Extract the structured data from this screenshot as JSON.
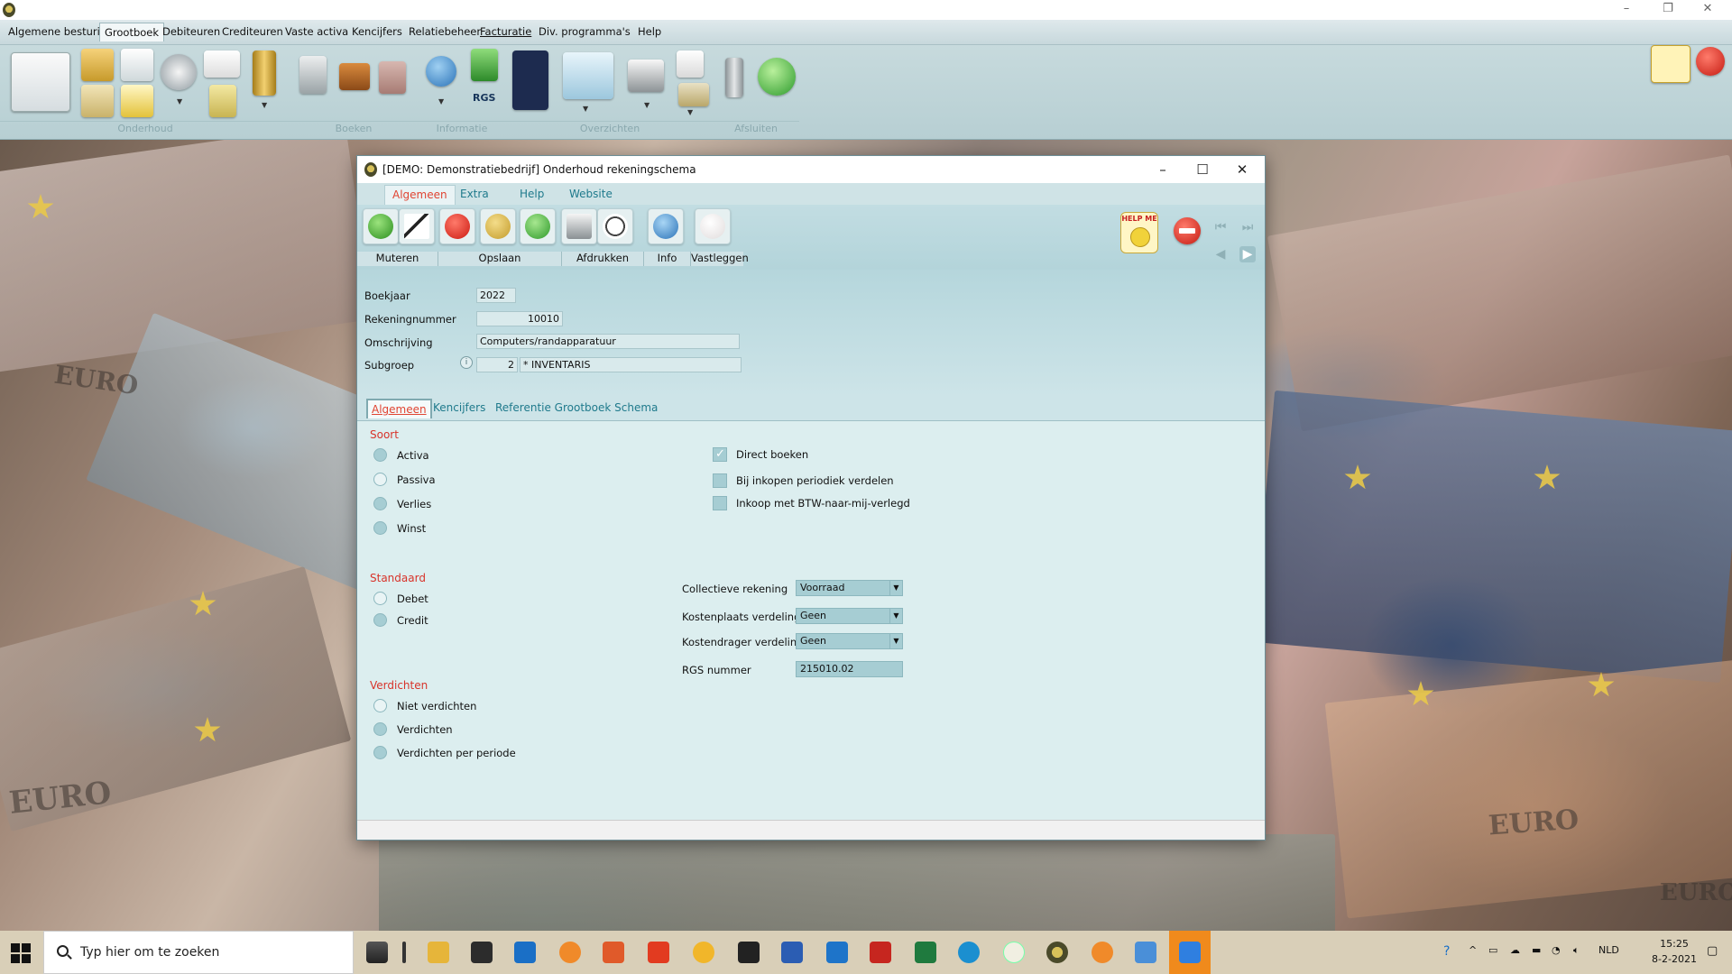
{
  "menubar": {
    "items": [
      "Algemene besturing",
      "Grootboek",
      "Debiteuren",
      "Crediteuren",
      "Vaste activa",
      "Kencijfers",
      "Relatiebeheer",
      "Facturatie",
      "Div. programma's",
      "Help"
    ]
  },
  "ribbon": {
    "groups": [
      "Onderhoud",
      "Boeken",
      "Informatie",
      "Overzichten",
      "Afsluiten"
    ],
    "rgs_label": "RGS"
  },
  "dialog": {
    "title": "[DEMO: Demonstratiebedrijf]  Onderhoud rekeningschema",
    "menu": [
      "Algemeen",
      "Extra",
      "Help",
      "Website"
    ],
    "toolbar_groups": [
      "Muteren",
      "Opslaan",
      "Afdrukken",
      "Info",
      "Vastleggen"
    ],
    "helpme_text": "HELP ME",
    "form": {
      "boekjaar_label": "Boekjaar",
      "boekjaar": "2022",
      "rekeningnummer_label": "Rekeningnummer",
      "rekeningnummer": "10010",
      "omschrijving_label": "Omschrijving",
      "omschrijving": "Computers/randapparatuur",
      "subgroep_label": "Subgroep",
      "subgroep_nr": "2",
      "subgroep_naam": "* INVENTARIS"
    },
    "tabs": [
      "Algemeen",
      "Kencijfers",
      "Referentie Grootboek Schema"
    ],
    "soort": {
      "title": "Soort",
      "options": [
        "Activa",
        "Passiva",
        "Verlies",
        "Winst"
      ]
    },
    "standaard": {
      "title": "Standaard",
      "options": [
        "Debet",
        "Credit"
      ]
    },
    "verdichten": {
      "title": "Verdichten",
      "options": [
        "Niet verdichten",
        "Verdichten",
        "Verdichten per periode"
      ]
    },
    "checkboxes": {
      "direct_boeken": "Direct boeken",
      "inkopen_periodiek": "Bij inkopen periodiek verdelen",
      "inkoop_btw": "Inkoop met BTW-naar-mij-verlegd"
    },
    "selects": {
      "collectieve_label": "Collectieve rekening",
      "collectieve_value": "Voorraad",
      "kostenplaats_label": "Kostenplaats verdeling",
      "kostenplaats_value": "Geen",
      "kostendrager_label": "Kostendrager verdeling",
      "kostendrager_value": "Geen",
      "rgs_label": "RGS nummer",
      "rgs_value": "215010.02"
    }
  },
  "desktop_text": {
    "euro1": "EURO",
    "euro2": "EURO",
    "euro3": "EURO",
    "euro4": "EURO"
  },
  "taskbar": {
    "search_placeholder": "Typ hier om te zoeken",
    "language": "NLD",
    "time": "15:25",
    "date": "8-2-2021"
  },
  "colors": {
    "accent": "#1f7a8c",
    "section_red": "#d8332a",
    "ribbon": "#c7dadd"
  }
}
